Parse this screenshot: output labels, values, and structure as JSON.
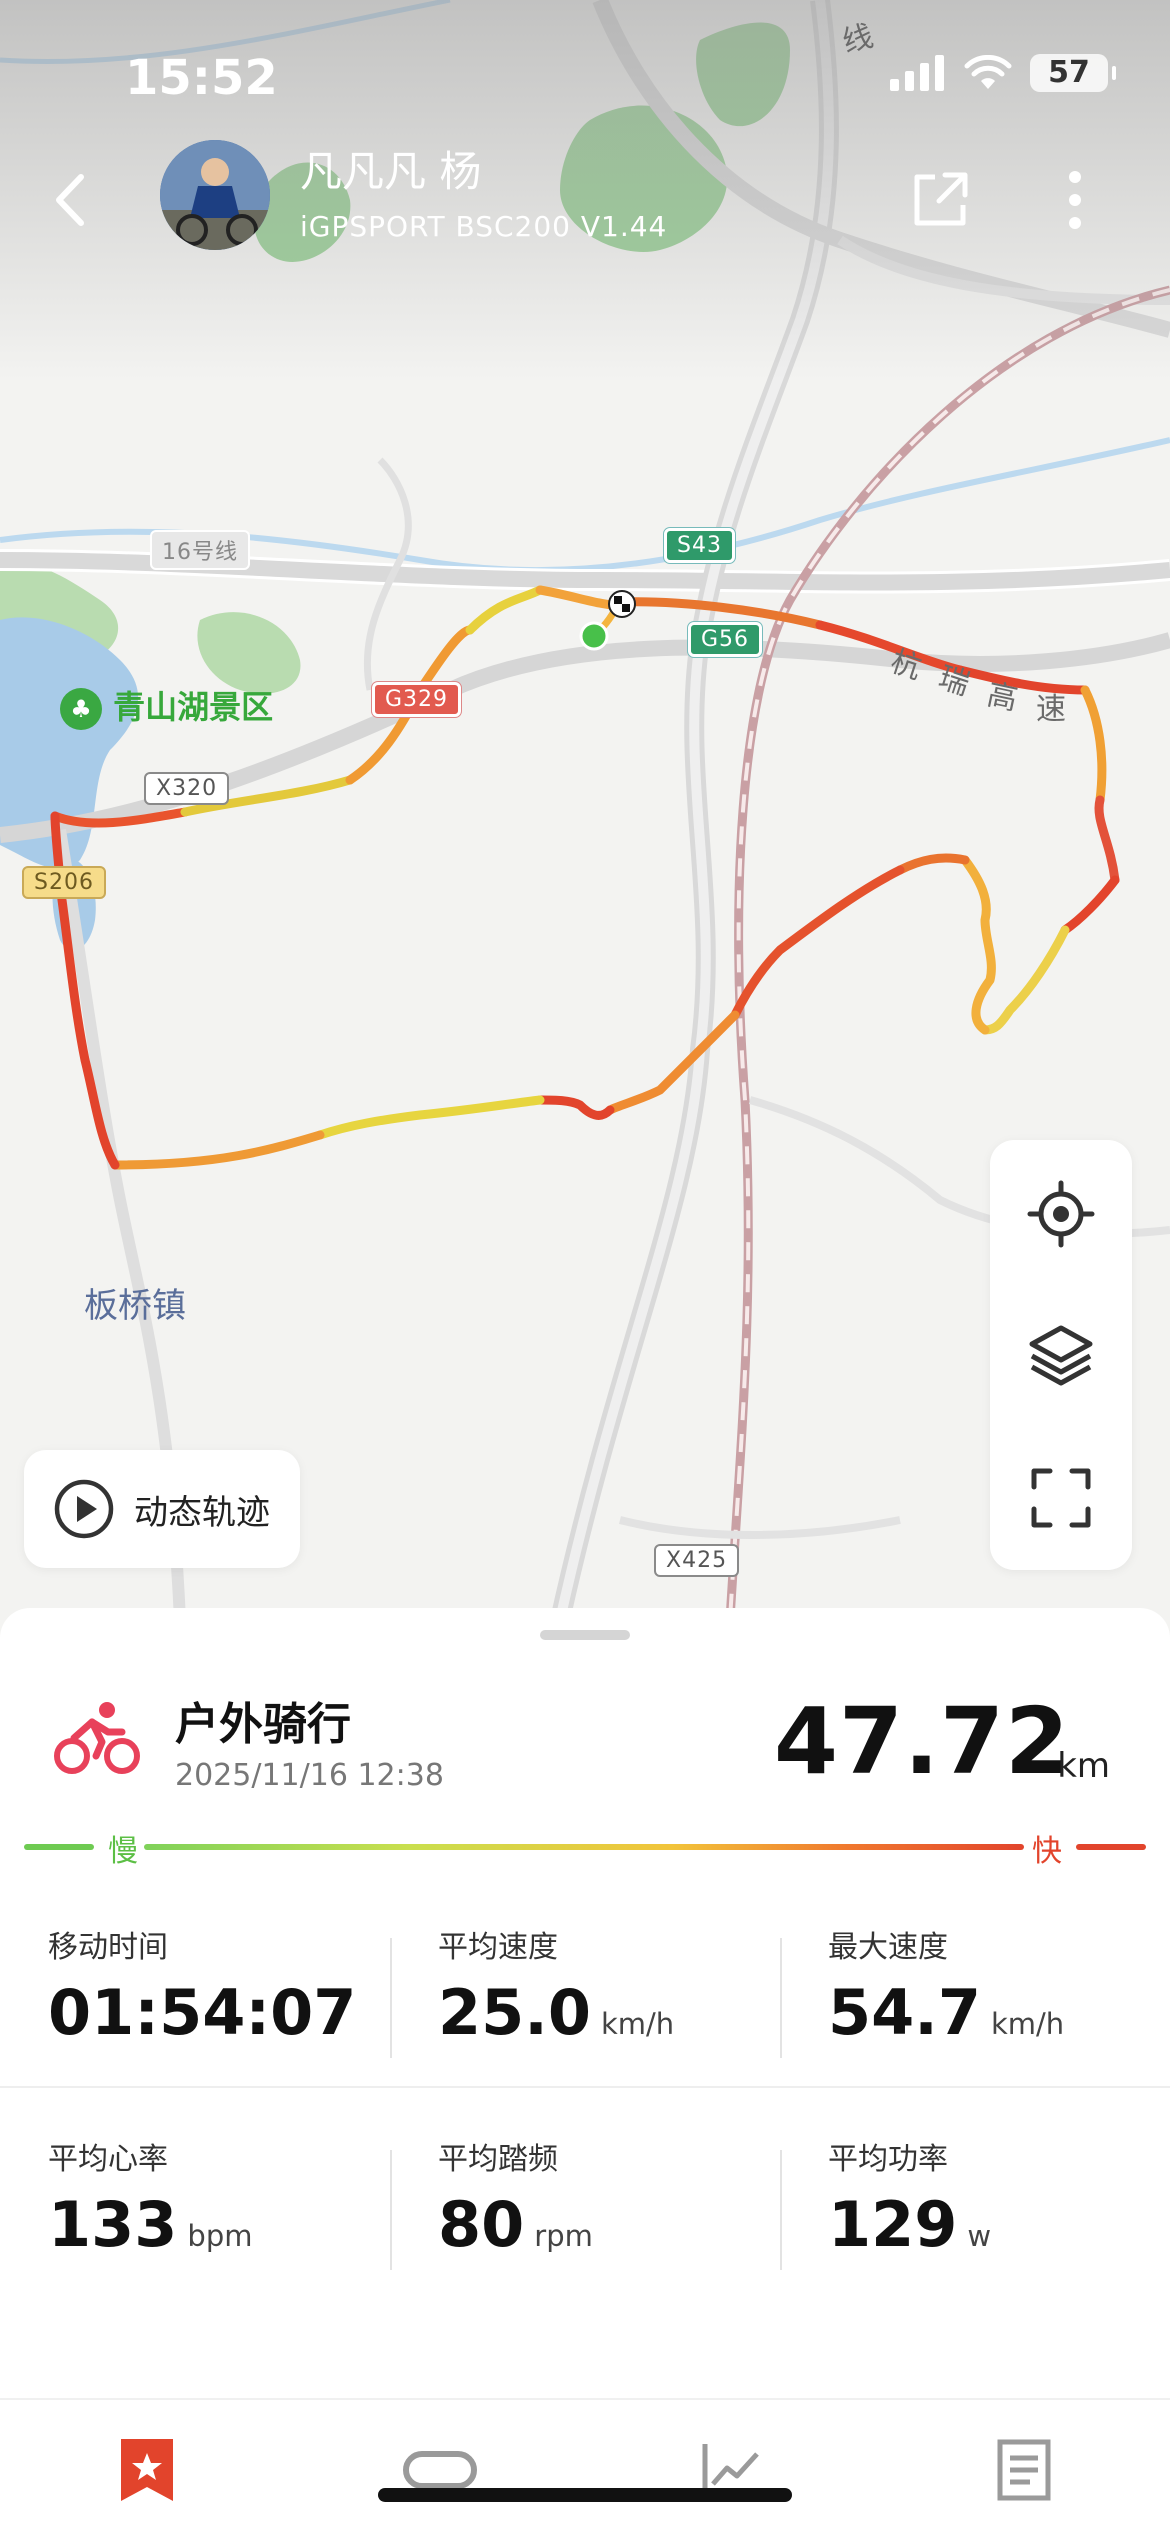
{
  "status_bar": {
    "time": "15:52",
    "battery": "57"
  },
  "header": {
    "user_name": "凡凡凡 杨",
    "device_name": "iGPSPORT BSC200 V1.44"
  },
  "map": {
    "labels": {
      "lake_area": "青山湖景区",
      "town": "板桥镇",
      "expressway_chars": [
        "杭",
        "瑞",
        "高",
        "速"
      ],
      "top_line_char": "线"
    },
    "road_signs": {
      "s43": "S43",
      "g56": "G56",
      "g329": "G329",
      "x320": "X320",
      "s206": "S206",
      "x425": "X425",
      "line16": "16号线"
    },
    "dynamic_track_label": "动态轨迹"
  },
  "activity": {
    "type": "户外骑行",
    "datetime": "2025/11/16 12:38",
    "distance": "47.72",
    "distance_unit": "km"
  },
  "speed_legend": {
    "slow": "慢",
    "fast": "快"
  },
  "stats": {
    "moving_time": {
      "label": "移动时间",
      "value": "01:54:07",
      "unit": ""
    },
    "avg_speed": {
      "label": "平均速度",
      "value": "25.0",
      "unit": "km/h"
    },
    "max_speed": {
      "label": "最大速度",
      "value": "54.7",
      "unit": "km/h"
    },
    "avg_hr": {
      "label": "平均心率",
      "value": "133",
      "unit": "bpm"
    },
    "avg_cadence": {
      "label": "平均踏频",
      "value": "80",
      "unit": "rpm"
    },
    "avg_power": {
      "label": "平均功率",
      "value": "129",
      "unit": "w"
    }
  },
  "tabs": [
    {
      "icon": "star-bookmark-icon",
      "active": true
    },
    {
      "icon": "lap-loop-icon",
      "active": false
    },
    {
      "icon": "chart-line-icon",
      "active": false
    },
    {
      "icon": "document-icon",
      "active": false
    }
  ],
  "colors": {
    "accent_red": "#e2442c",
    "slow_green": "#5cbf45",
    "activity_pink": "#e8415a"
  }
}
